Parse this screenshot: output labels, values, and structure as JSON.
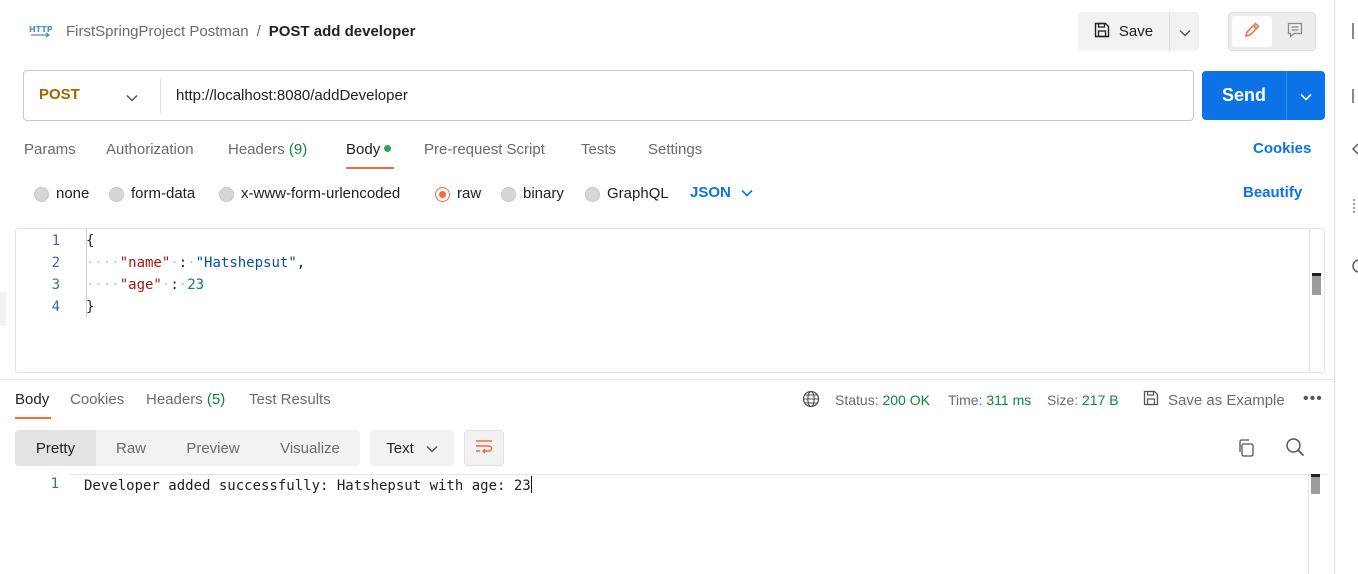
{
  "breadcrumb": {
    "collection": "FirstSpringProject Postman",
    "separator": "/",
    "request": "POST add developer",
    "icon": "http-icon"
  },
  "toolbar": {
    "save_label": "Save",
    "save_icon": "save-icon",
    "edit_icon": "pencil-icon",
    "doc_icon": "comment-icon"
  },
  "request": {
    "method": "POST",
    "url": "http://localhost:8080/addDeveloper",
    "send_label": "Send"
  },
  "request_tabs": [
    {
      "label": "Params"
    },
    {
      "label": "Authorization"
    },
    {
      "label": "Headers",
      "count": "(9)"
    },
    {
      "label": "Body",
      "active": true
    },
    {
      "label": "Pre-request Script"
    },
    {
      "label": "Tests"
    },
    {
      "label": "Settings"
    }
  ],
  "cookies_label": "Cookies",
  "body_types": [
    {
      "label": "none"
    },
    {
      "label": "form-data"
    },
    {
      "label": "x-www-form-urlencoded"
    },
    {
      "label": "raw",
      "selected": true
    },
    {
      "label": "binary"
    },
    {
      "label": "GraphQL"
    }
  ],
  "body_format": "JSON",
  "beautify_label": "Beautify",
  "request_body": {
    "line_numbers": [
      "1",
      "2",
      "3",
      "4"
    ],
    "open_brace": "{",
    "close_brace": "}",
    "key1": "\"name\"",
    "val1": "\"Hatshepsut\"",
    "key2": "\"age\"",
    "val2": "23",
    "colon": ":",
    "comma": ","
  },
  "response_tabs": [
    {
      "label": "Body",
      "active": true
    },
    {
      "label": "Cookies"
    },
    {
      "label": "Headers",
      "count": "(5)"
    },
    {
      "label": "Test Results"
    }
  ],
  "response_meta": {
    "status_label": "Status:",
    "status_value": "200 OK",
    "time_label": "Time:",
    "time_value": "311 ms",
    "size_label": "Size:",
    "size_value": "217 B",
    "save_example_label": "Save as Example",
    "more_label": "•••"
  },
  "view_options": [
    "Pretty",
    "Raw",
    "Preview",
    "Visualize"
  ],
  "response_format": "Text",
  "response_body": {
    "line_number": "1",
    "text": "Developer added successfully: Hatshepsut with age: 23"
  },
  "colors": {
    "accent": "#f26b3a",
    "primary": "#0b73e6",
    "success": "#0a8a3a",
    "method_post": "#a66400"
  }
}
